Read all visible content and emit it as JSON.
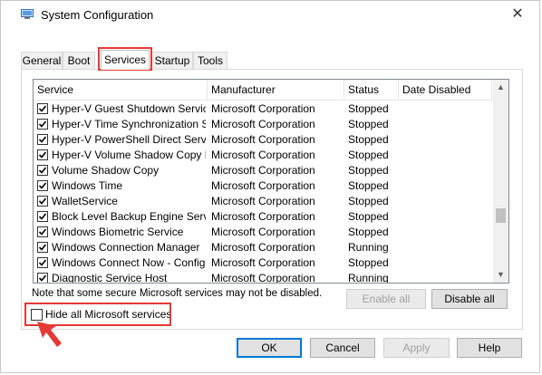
{
  "window": {
    "title": "System Configuration",
    "close_glyph": "✕"
  },
  "tabs": [
    "General",
    "Boot",
    "Services",
    "Startup",
    "Tools"
  ],
  "active_tab": "Services",
  "columns": {
    "service": "Service",
    "manufacturer": "Manufacturer",
    "status": "Status",
    "date_disabled": "Date Disabled"
  },
  "services": [
    {
      "service": "Hyper-V Guest Shutdown Service",
      "manufacturer": "Microsoft Corporation",
      "status": "Stopped",
      "date_disabled": "",
      "checked": true
    },
    {
      "service": "Hyper-V Time Synchronization S...",
      "manufacturer": "Microsoft Corporation",
      "status": "Stopped",
      "date_disabled": "",
      "checked": true
    },
    {
      "service": "Hyper-V PowerShell Direct Service",
      "manufacturer": "Microsoft Corporation",
      "status": "Stopped",
      "date_disabled": "",
      "checked": true
    },
    {
      "service": "Hyper-V Volume Shadow Copy R...",
      "manufacturer": "Microsoft Corporation",
      "status": "Stopped",
      "date_disabled": "",
      "checked": true
    },
    {
      "service": "Volume Shadow Copy",
      "manufacturer": "Microsoft Corporation",
      "status": "Stopped",
      "date_disabled": "",
      "checked": true
    },
    {
      "service": "Windows Time",
      "manufacturer": "Microsoft Corporation",
      "status": "Stopped",
      "date_disabled": "",
      "checked": true
    },
    {
      "service": "WalletService",
      "manufacturer": "Microsoft Corporation",
      "status": "Stopped",
      "date_disabled": "",
      "checked": true
    },
    {
      "service": "Block Level Backup Engine Service",
      "manufacturer": "Microsoft Corporation",
      "status": "Stopped",
      "date_disabled": "",
      "checked": true
    },
    {
      "service": "Windows Biometric Service",
      "manufacturer": "Microsoft Corporation",
      "status": "Stopped",
      "date_disabled": "",
      "checked": true
    },
    {
      "service": "Windows Connection Manager",
      "manufacturer": "Microsoft Corporation",
      "status": "Running",
      "date_disabled": "",
      "checked": true
    },
    {
      "service": "Windows Connect Now - Config ...",
      "manufacturer": "Microsoft Corporation",
      "status": "Stopped",
      "date_disabled": "",
      "checked": true
    },
    {
      "service": "Diagnostic Service Host",
      "manufacturer": "Microsoft Corporation",
      "status": "Running",
      "date_disabled": "",
      "checked": true
    }
  ],
  "scroll_position": 0.72,
  "note": "Note that some secure Microsoft services may not be disabled.",
  "buttons": {
    "enable_all": "Enable all",
    "disable_all": "Disable all",
    "ok": "OK",
    "cancel": "Cancel",
    "apply": "Apply",
    "help": "Help"
  },
  "hide_ms": {
    "label": "Hide all Microsoft services",
    "checked": false
  },
  "colors": {
    "highlight": "#e53935",
    "default_button": "#0078d7"
  }
}
